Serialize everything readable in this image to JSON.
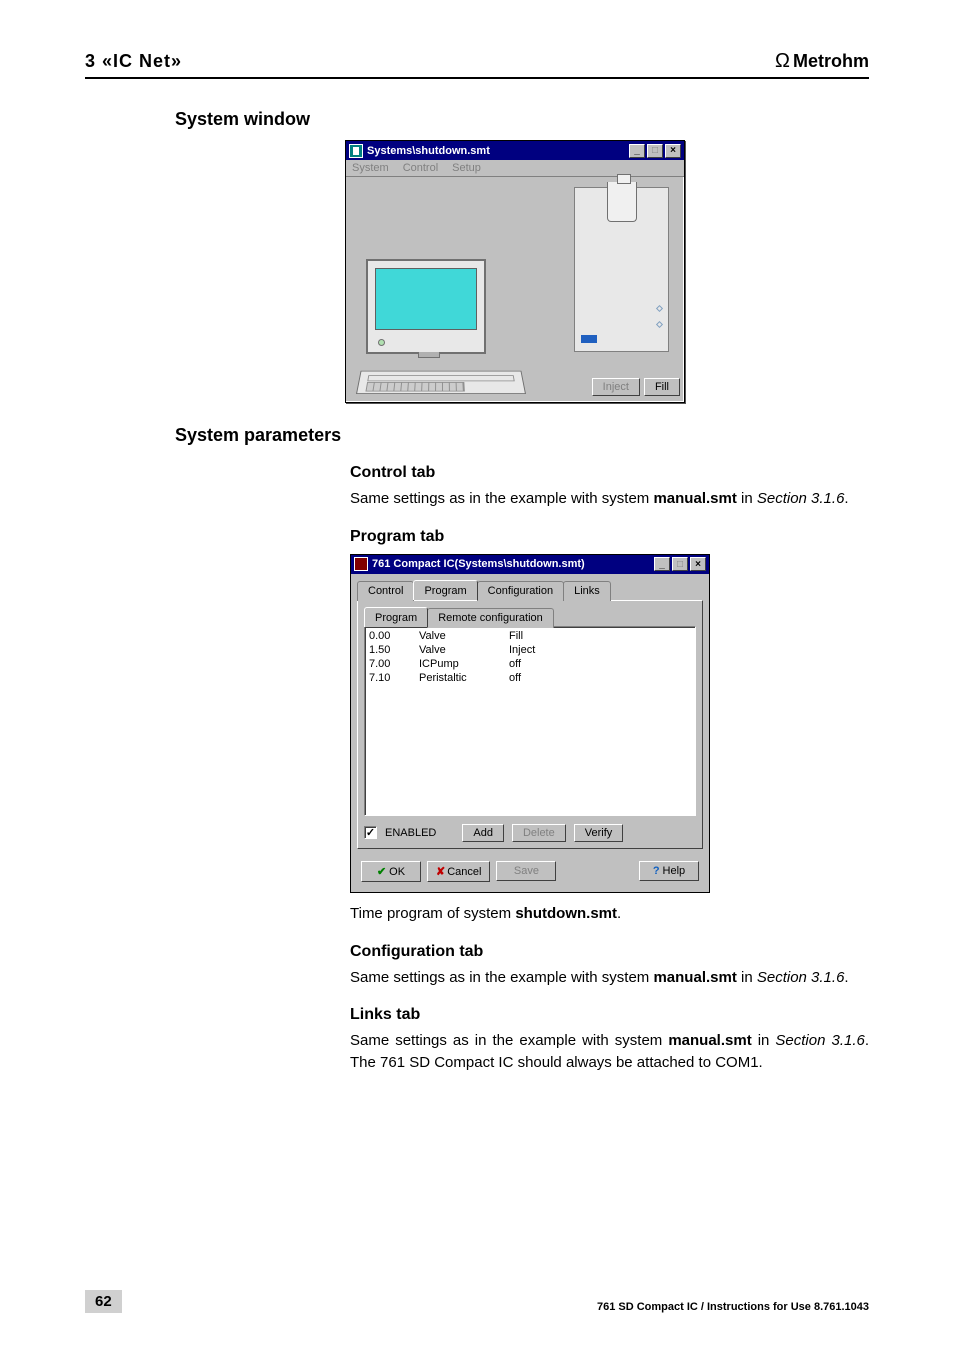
{
  "header": {
    "left": "3 «IC Net»",
    "right_brand": "Metrohm"
  },
  "sections": {
    "system_window": "System window",
    "system_parameters": "System parameters",
    "control_tab": "Control tab",
    "program_tab": "Program tab",
    "config_tab": "Configuration tab",
    "links_tab": "Links tab"
  },
  "text": {
    "control_body_a": "Same settings as in the example with system ",
    "control_body_b": "manual.smt",
    "control_body_c": " in ",
    "control_body_d": "Section 3.1.6",
    "control_body_e": ".",
    "program_caption_a": "Time program of system ",
    "program_caption_b": "shutdown.smt",
    "program_caption_c": ".",
    "config_body_a": "Same settings as in the example with system ",
    "config_body_b": "manual.smt",
    "config_body_c": " in ",
    "config_body_d": "Section 3.1.6",
    "config_body_e": ".",
    "links_body_a": "Same settings as in the example with system ",
    "links_body_b": "manual.smt",
    "links_body_c": " in ",
    "links_body_d": "Section 3.1.6",
    "links_body_e": ". The 761 SD Compact IC should always be attached to COM1."
  },
  "win1": {
    "title": "Systems\\shutdown.smt",
    "menu": {
      "system": "System",
      "control": "Control",
      "setup": "Setup"
    },
    "buttons": {
      "inject": "Inject",
      "fill": "Fill"
    }
  },
  "dialog": {
    "title": "761 Compact IC(Systems\\shutdown.smt)",
    "tabs": {
      "control": "Control",
      "program": "Program",
      "config": "Configuration",
      "links": "Links"
    },
    "subtabs": {
      "program": "Program",
      "remote": "Remote configuration"
    },
    "rows": [
      {
        "t": "0.00",
        "d": "Valve",
        "v": "Fill"
      },
      {
        "t": "1.50",
        "d": "Valve",
        "v": "Inject"
      },
      {
        "t": "7.00",
        "d": "ICPump",
        "v": "off"
      },
      {
        "t": "7.10",
        "d": "Peristaltic",
        "v": "off"
      }
    ],
    "enabled_label": "ENABLED",
    "btns": {
      "add": "Add",
      "delete": "Delete",
      "verify": "Verify",
      "ok": "OK",
      "cancel": "Cancel",
      "save": "Save",
      "help": "Help"
    }
  },
  "footer": {
    "page": "62",
    "right": "761 SD Compact IC / Instructions for Use   8.761.1043"
  }
}
